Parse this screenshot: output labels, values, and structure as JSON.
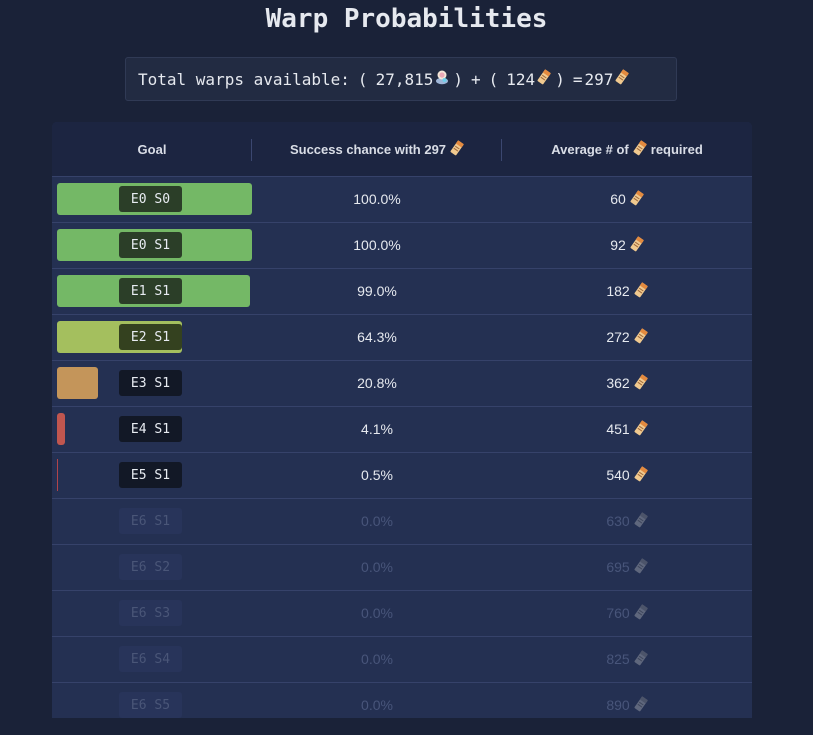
{
  "title": "Warp Probabilities",
  "totals": {
    "label": "Total warps available:",
    "open_paren_1": "(",
    "jade_amount": "27,815",
    "close_paren_1": ")",
    "plus": "+",
    "open_paren_2": "(",
    "ticket_amount": "124",
    "close_paren_2": ")",
    "equals": "=",
    "total": "297",
    "icons": [
      "stellar-jade-icon",
      "warp-ticket-icon"
    ]
  },
  "table": {
    "headers": {
      "goal": "Goal",
      "chance_prefix": "Success chance with 297",
      "avg_prefix": "Average # of",
      "avg_suffix": "required"
    },
    "rows": [
      {
        "goal": "E0 S0",
        "chance": "100.0%",
        "chance_value": 100.0,
        "avg": "60",
        "bar_color": "#74b866",
        "badge_bg": "#2b3e28"
      },
      {
        "goal": "E0 S1",
        "chance": "100.0%",
        "chance_value": 100.0,
        "avg": "92",
        "bar_color": "#74b866",
        "badge_bg": "#2b3e28"
      },
      {
        "goal": "E1 S1",
        "chance": "99.0%",
        "chance_value": 99.0,
        "avg": "182",
        "bar_color": "#74b866",
        "badge_bg": "#2b3e28"
      },
      {
        "goal": "E2 S1",
        "chance": "64.3%",
        "chance_value": 64.3,
        "avg": "272",
        "bar_color": "#a4bf5e",
        "badge_bg": "#34411f"
      },
      {
        "goal": "E3 S1",
        "chance": "20.8%",
        "chance_value": 20.8,
        "avg": "362",
        "bar_color": "#c4955a",
        "badge_bg": "#121826"
      },
      {
        "goal": "E4 S1",
        "chance": "4.1%",
        "chance_value": 4.1,
        "avg": "451",
        "bar_color": "#c0564f",
        "badge_bg": "#121826"
      },
      {
        "goal": "E5 S1",
        "chance": "0.5%",
        "chance_value": 0.5,
        "avg": "540",
        "bar_color": "#b0444a",
        "badge_bg": "#121826"
      },
      {
        "goal": "E6 S1",
        "chance": "0.0%",
        "chance_value": 0.0,
        "avg": "630",
        "bar_color": "#b0444a",
        "badge_bg": "#28345a"
      },
      {
        "goal": "E6 S2",
        "chance": "0.0%",
        "chance_value": 0.0,
        "avg": "695",
        "bar_color": "#b0444a",
        "badge_bg": "#28345a"
      },
      {
        "goal": "E6 S3",
        "chance": "0.0%",
        "chance_value": 0.0,
        "avg": "760",
        "bar_color": "#b0444a",
        "badge_bg": "#28345a"
      },
      {
        "goal": "E6 S4",
        "chance": "0.0%",
        "chance_value": 0.0,
        "avg": "825",
        "bar_color": "#b0444a",
        "badge_bg": "#28345a"
      },
      {
        "goal": "E6 S5",
        "chance": "0.0%",
        "chance_value": 0.0,
        "avg": "890",
        "bar_color": "#b0444a",
        "badge_bg": "#28345a"
      }
    ]
  }
}
